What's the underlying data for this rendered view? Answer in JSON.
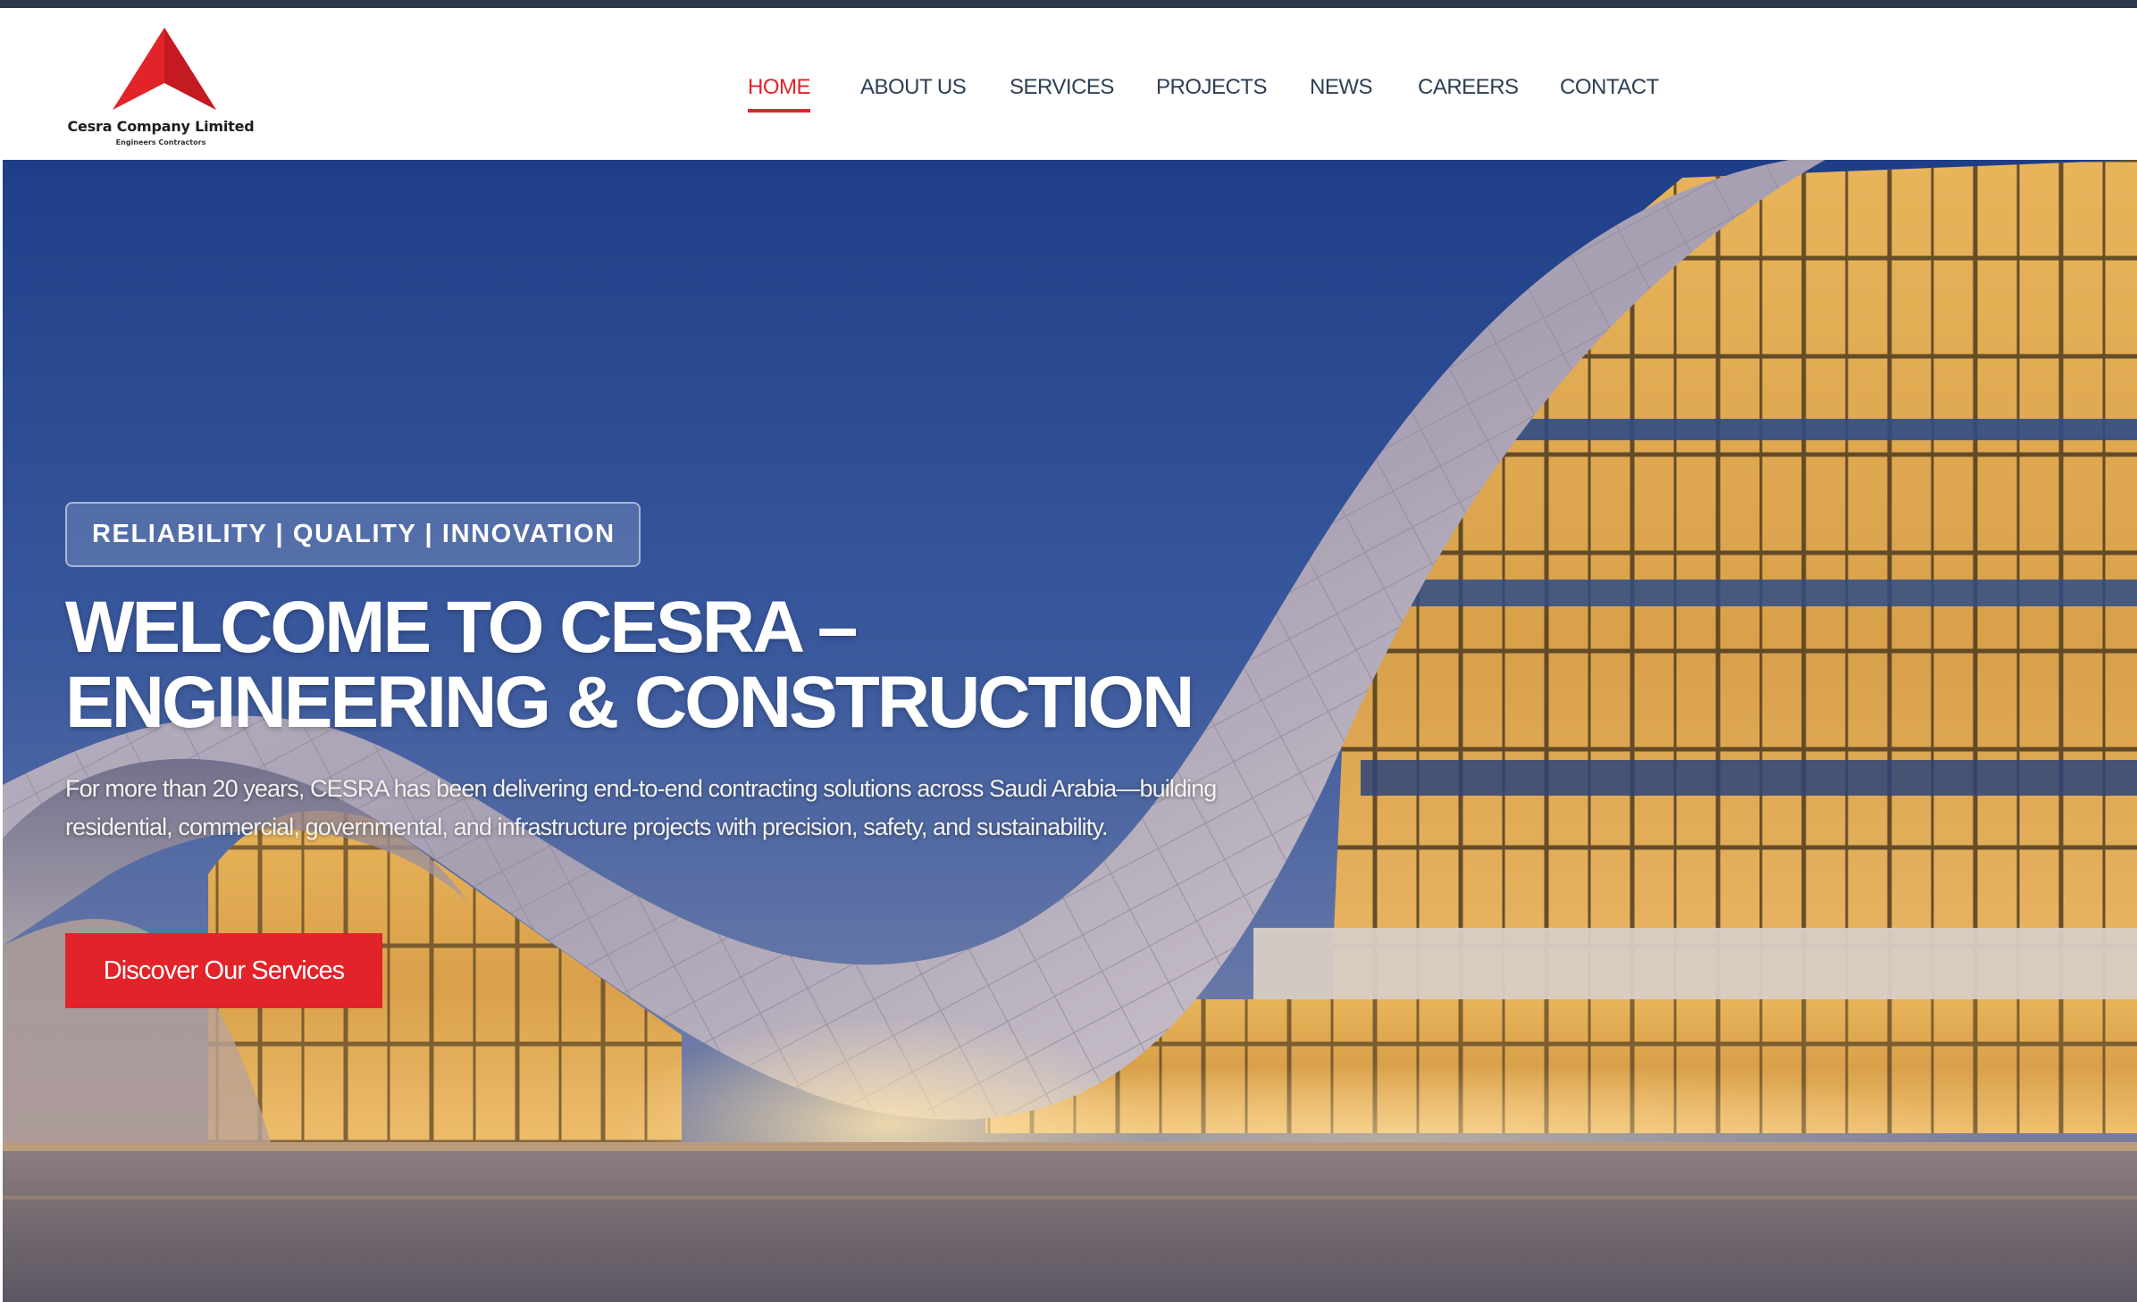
{
  "brand": {
    "name": "Cesra Company Limited",
    "tagline": "Engineers Contractors",
    "logo_icon": "red-peak-triangle",
    "accent_color": "#e2232a",
    "text_color": "#2d3f55"
  },
  "nav": {
    "items": [
      {
        "label": "HOME",
        "active": true
      },
      {
        "label": "ABOUT US",
        "active": false
      },
      {
        "label": "SERVICES",
        "active": false
      },
      {
        "label": "PROJECTS",
        "active": false
      },
      {
        "label": "NEWS",
        "active": false
      },
      {
        "label": "CAREERS",
        "active": false
      },
      {
        "label": "CONTACT",
        "active": false
      }
    ]
  },
  "hero": {
    "badge": "RELIABILITY | QUALITY | INNOVATION",
    "title_line1": "WELCOME TO CESRA –",
    "title_line2": "ENGINEERING & CONSTRUCTION",
    "description": "For more than 20 years, CESRA has been delivering end-to-end contracting solutions across Saudi Arabia—building residential, commercial, governmental, and infrastructure projects with precision, safety, and sustainability.",
    "cta_label": "Discover Our Services",
    "background": "curved-white-building-at-dusk-photo"
  }
}
